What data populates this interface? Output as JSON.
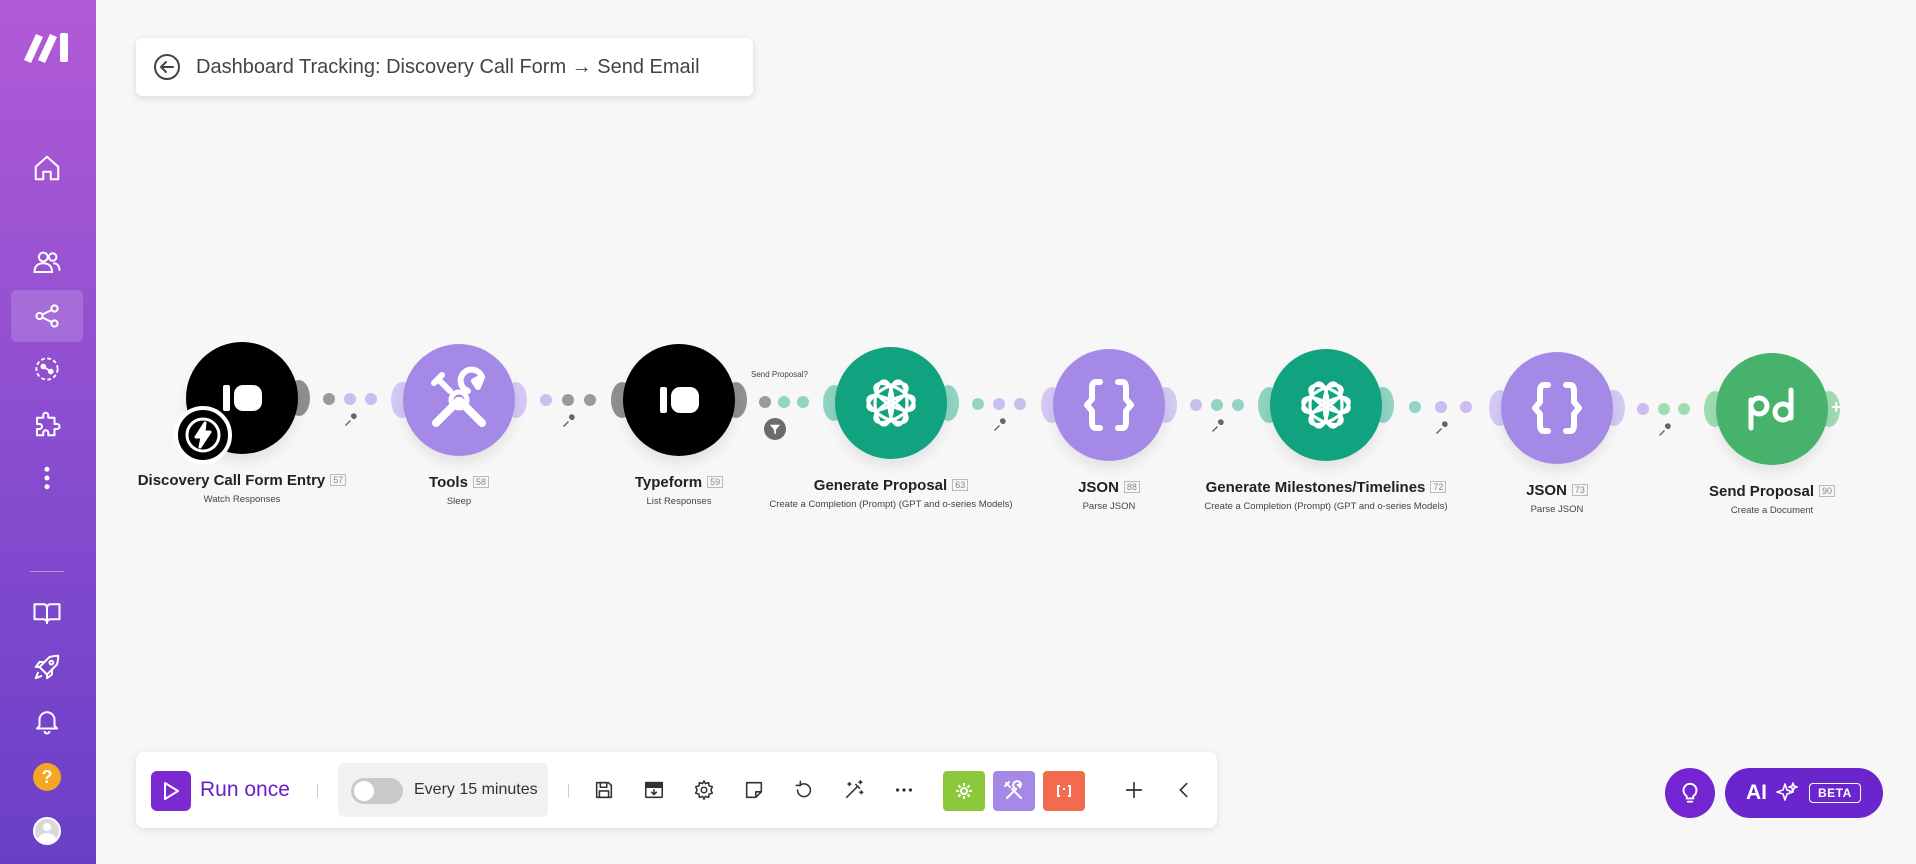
{
  "scenario": {
    "title": "Dashboard Tracking: Discovery Call Form → Send Email"
  },
  "sidebar": {
    "items": [
      "logo-icon",
      "home-icon",
      "team-icon",
      "scenarios-icon",
      "connections-icon",
      "templates-icon",
      "more-icon",
      "docs-icon",
      "launch-icon",
      "notifications-icon",
      "help-icon",
      "avatar"
    ]
  },
  "modules": [
    {
      "name": "Discovery Call Form Entry",
      "id": "57",
      "sub": "Watch Responses",
      "color": "#000000",
      "icon": "typeform-icon"
    },
    {
      "name": "Tools",
      "id": "58",
      "sub": "Sleep",
      "color": "#a48ae6",
      "icon": "tools-icon"
    },
    {
      "name": "Typeform",
      "id": "59",
      "sub": "List Responses",
      "color": "#000000",
      "icon": "typeform-icon"
    },
    {
      "name": "Generate Proposal",
      "id": "63",
      "sub": "Create a Completion (Prompt) (GPT and o-series Models)",
      "color": "#11a37f",
      "icon": "openai-icon"
    },
    {
      "name": "JSON",
      "id": "88",
      "sub": "Parse JSON",
      "color": "#a48ae6",
      "icon": "json-icon"
    },
    {
      "name": "Generate Milestones/Timelines",
      "id": "72",
      "sub": "Create a Completion (Prompt) (GPT and o-series Models)",
      "color": "#11a37f",
      "icon": "openai-icon"
    },
    {
      "name": "JSON",
      "id": "73",
      "sub": "Parse JSON",
      "color": "#a48ae6",
      "icon": "json-icon"
    },
    {
      "name": "Send Proposal",
      "id": "90",
      "sub": "Create a Document",
      "color": "#46b26c",
      "icon": "pandadoc-icon"
    }
  ],
  "filter": {
    "label": "Send Proposal?"
  },
  "toolbar": {
    "run_label": "Run once",
    "schedule_label": "Every 15 minutes",
    "schedule_enabled": false
  },
  "ai": {
    "label": "AI",
    "badge": "BETA"
  }
}
